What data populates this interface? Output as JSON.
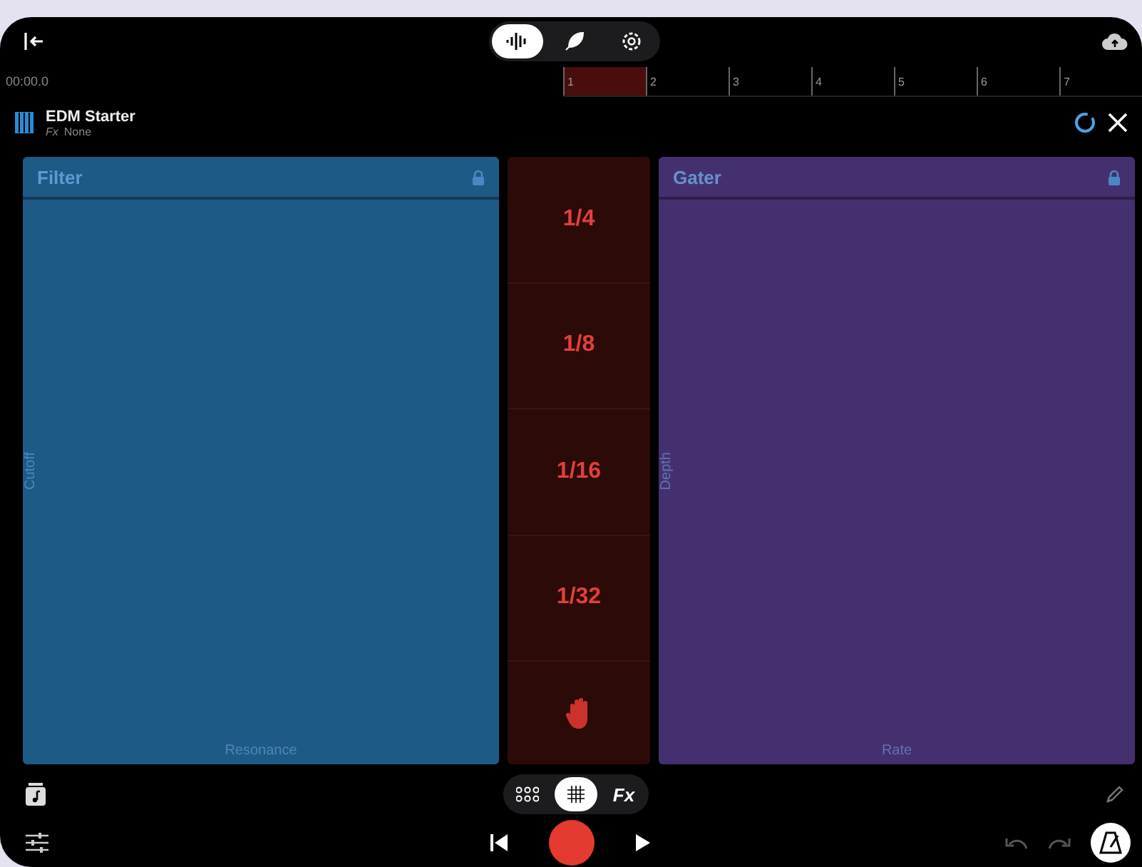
{
  "top_tabs": [
    {
      "kind": "waveform",
      "selected": true
    },
    {
      "kind": "feather",
      "selected": false
    },
    {
      "kind": "settings",
      "selected": false
    }
  ],
  "timeline": {
    "time": "00:00.0",
    "bars": [
      "1",
      "2",
      "3",
      "4",
      "5",
      "6",
      "7"
    ]
  },
  "track": {
    "name": "EDM Starter",
    "fx_label": "Fx",
    "fx_value": "None"
  },
  "pads": [
    {
      "title": "Filter",
      "locked": true,
      "y_label": "Cutoff",
      "x_label": "Resonance",
      "color": "#1d5a86"
    },
    {
      "title": "Gater",
      "locked": true,
      "y_label": "Depth",
      "x_label": "Rate",
      "color": "#45306f"
    }
  ],
  "divisions": [
    "1/4",
    "1/8",
    "1/16",
    "1/32"
  ],
  "modes": [
    {
      "kind": "dots",
      "selected": false
    },
    {
      "kind": "grid",
      "selected": true
    },
    {
      "kind": "text",
      "label": "Fx",
      "selected": false
    }
  ]
}
